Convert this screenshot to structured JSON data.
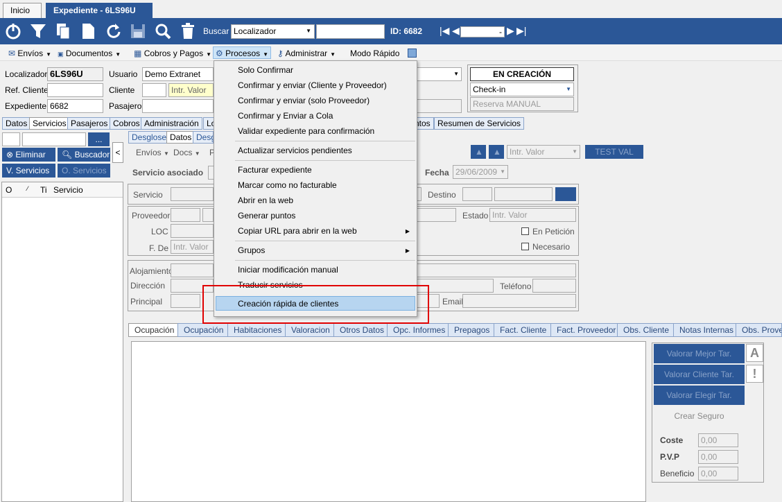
{
  "tabs_top": {
    "inicio": "Inicio",
    "expediente": "Expediente  -  6LS96U"
  },
  "toolbar": {
    "buscar_label": "Buscar",
    "buscar_select": "Localizador",
    "id_label": "ID: 6682",
    "nav_value": "-"
  },
  "menubar": {
    "envios": "Envíos",
    "documentos": "Documentos",
    "cobros": "Cobros y Pagos",
    "procesos": "Procesos",
    "administrar": "Administrar",
    "modo_rapido": "Modo Rápido"
  },
  "header": {
    "localizador_label": "Localizador",
    "localizador_value": "6LS96U",
    "usuario_label": "Usuario",
    "usuario_value": "Demo Extranet",
    "ref_cliente_label": "Ref. Cliente",
    "cliente_label": "Cliente",
    "cliente_placeholder": "Intr. Valor",
    "expediente_label": "Expediente",
    "expediente_value": "6682",
    "pasajero_label": "Pasajero",
    "estado": "EN CREACIÓN",
    "checkin": "Check-in",
    "reserva_manual": "Reserva MANUAL"
  },
  "main_tabs": [
    "Datos",
    "Servicios",
    "Pasajeros",
    "Cobros",
    "Administración",
    "Lo",
    "ntos",
    "Resumen de Servicios"
  ],
  "left": {
    "more_btn": "...",
    "eliminar": "Eliminar",
    "buscador": "Buscador",
    "v_servicios": "V. Servicios",
    "o_servicios": "O. Servicios",
    "col_o": "O",
    "col_sort": "⁄",
    "col_ti": "Ti",
    "col_servicio": "Servicio",
    "collapse": "<"
  },
  "sub_tabs": [
    "Desglose",
    "Datos",
    "Desg"
  ],
  "sub_menu": {
    "envios": "Envíos",
    "docs": "Docs",
    "p": "P"
  },
  "service": {
    "intr_valor": "Intr. Valor",
    "test_val": "TEST VAL",
    "servicio_asociado": "Servicio asociado",
    "fecha_label": "Fecha",
    "fecha_value": "29/06/2009",
    "servicio_label": "Servicio",
    "destino_label": "Destino",
    "proveedor_label": "Proveedor",
    "estado_label": "Estado",
    "estado_placeholder": "Intr. Valor",
    "loc_label": "LOC",
    "en_peticion": "En Petición",
    "fde_label": "F. De",
    "fde_placeholder": "Intr. Valor",
    "necesario": "Necesario",
    "alojamiento": "Alojamiento",
    "direccion": "Dirección",
    "telefono": "Teléfono",
    "principal": "Principal",
    "email": "Email"
  },
  "dropdown": {
    "items": [
      "Solo Confirmar",
      "Confirmar y enviar (Cliente y Proveedor)",
      "Confirmar y enviar (solo Proveedor)",
      "Confirmar y Enviar a Cola",
      "Validar expediente para confirmación",
      "Actualizar servicios pendientes",
      "Facturar expediente",
      "Marcar como no facturable",
      "Abrir en la web",
      "Generar puntos",
      "Copiar URL para abrir en la web",
      "Grupos",
      "Iniciar modificación manual",
      "Traducir servicios",
      "Creación rápida de clientes"
    ]
  },
  "bottom_tabs": [
    "Ocupación",
    "Ocupación",
    "Habitaciones",
    "Valoracion",
    "Otros Datos",
    "Opc. Informes",
    "Prepagos",
    "Fact. Cliente",
    "Fact. Proveedor",
    "Obs. Cliente",
    "Notas Internas",
    "Obs. Prove"
  ],
  "valorar": {
    "mejor": "Valorar Mejor Tar.",
    "cliente": "Valorar Cliente Tar.",
    "elegir": "Valorar Elegir Tar.",
    "crear_seguro": "Crear Seguro",
    "btn_a": "A",
    "btn_excl": "!",
    "coste_label": "Coste",
    "coste_value": "0,00",
    "pvp_label": "P.V.P",
    "pvp_value": "0,00",
    "beneficio_label": "Beneficio",
    "beneficio_value": "0,00"
  },
  "colors": {
    "brand": "#2b5797",
    "highlight": "#b7d5f0",
    "annotation": "#e00000"
  }
}
